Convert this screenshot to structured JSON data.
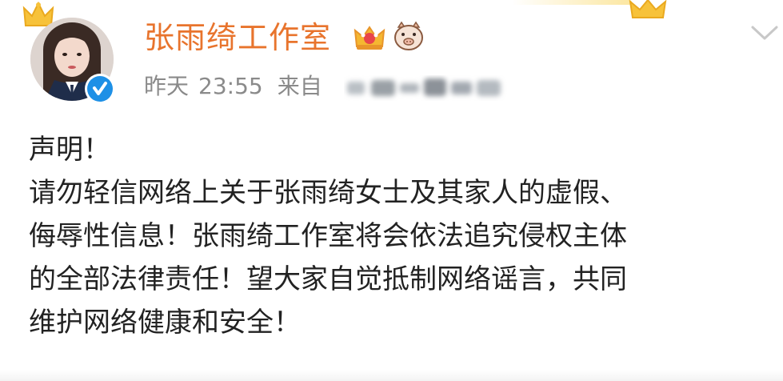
{
  "post": {
    "username": "张雨绮工作室",
    "timestamp": "昨天",
    "time": "23:55",
    "source_prefix": "来自",
    "body_lines": [
      "声明！",
      "请勿轻信网络上关于张雨绮女士及其家人的虚假、",
      "侮辱性信息！张雨绮工作室将会依法追究侵权主体",
      "的全部法律责任！望大家自觉抵制网络谣言，共同",
      "维护网络健康和安全！"
    ]
  },
  "colors": {
    "username": "#e8742d",
    "meta": "#8a8a8a",
    "body_text": "#222222",
    "verified": "#1e90e6",
    "crown_gold": "#f5b731",
    "crown_red": "#e8454a"
  },
  "icons": {
    "avatar": "avatar",
    "verified": "verified-badge-icon",
    "vip": "vip-crown-icon",
    "fan_badge": "pig-icon",
    "menu": "chevron-down-icon"
  }
}
